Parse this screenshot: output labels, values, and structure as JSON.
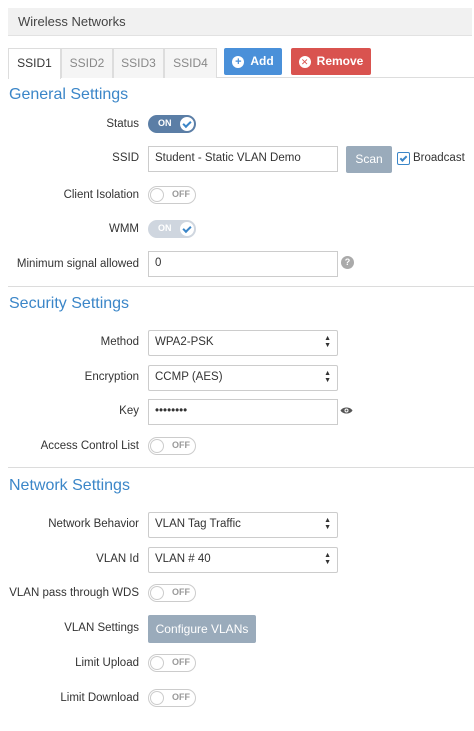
{
  "panel": {
    "title": "Wireless Networks"
  },
  "tabs": [
    {
      "label": "SSID1",
      "active": true
    },
    {
      "label": "SSID2",
      "active": false
    },
    {
      "label": "SSID3",
      "active": false
    },
    {
      "label": "SSID4",
      "active": false
    }
  ],
  "actions": {
    "add_label": "Add",
    "add_icon": "plus-icon",
    "remove_label": "Remove",
    "remove_icon": "times-icon"
  },
  "general": {
    "title": "General Settings",
    "status": {
      "label": "Status",
      "value": "ON"
    },
    "ssid": {
      "label": "SSID",
      "value": "Student - Static VLAN Demo",
      "scan_label": "Scan",
      "broadcast_label": "Broadcast",
      "broadcast_checked": true
    },
    "client_isolation": {
      "label": "Client Isolation",
      "value": "OFF"
    },
    "wmm": {
      "label": "WMM",
      "value": "ON"
    },
    "min_signal": {
      "label": "Minimum signal allowed",
      "value": "0",
      "help_icon": "?"
    }
  },
  "security": {
    "title": "Security Settings",
    "method": {
      "label": "Method",
      "value": "WPA2-PSK"
    },
    "encryption": {
      "label": "Encryption",
      "value": "CCMP (AES)"
    },
    "key": {
      "label": "Key",
      "value": "••••••••"
    },
    "acl": {
      "label": "Access Control List",
      "value": "OFF"
    }
  },
  "network": {
    "title": "Network Settings",
    "behavior": {
      "label": "Network Behavior",
      "value": "VLAN Tag Traffic"
    },
    "vlan_id": {
      "label": "VLAN Id",
      "value": "VLAN # 40"
    },
    "vlan_wds": {
      "label": "VLAN pass through WDS",
      "value": "OFF"
    },
    "vlan_settings": {
      "label": "VLAN Settings",
      "button_label": "Configure VLANs"
    },
    "limit_upload": {
      "label": "Limit Upload",
      "value": "OFF"
    },
    "limit_download": {
      "label": "Limit Download",
      "value": "OFF"
    }
  },
  "colors": {
    "accent": "#3b86c8",
    "add_button": "#4a90d9",
    "remove_button": "#d9534f",
    "secondary_button": "#9aabbb",
    "toggle_on": "#5b7ea6"
  }
}
